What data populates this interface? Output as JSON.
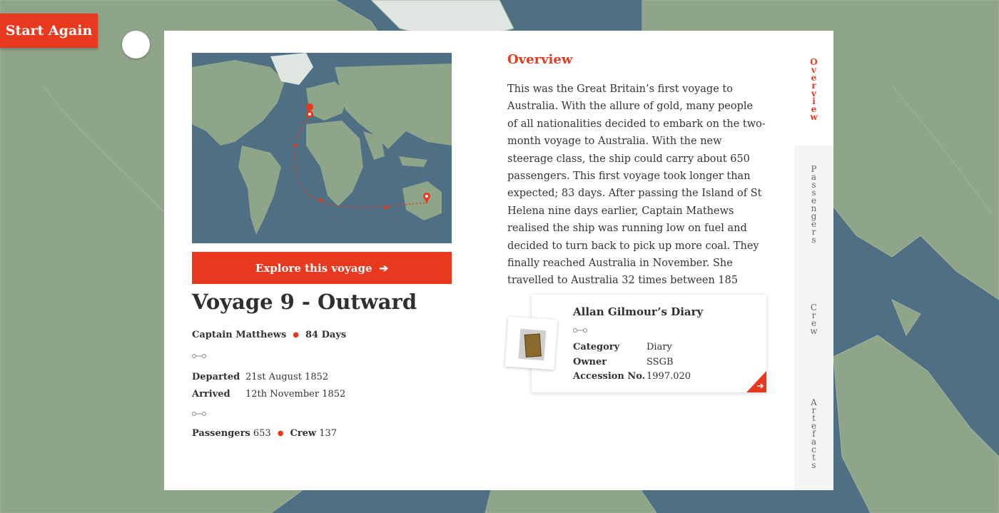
{
  "header": {
    "start_again_label": "Start Again"
  },
  "voyage": {
    "explore_label": "Explore this voyage",
    "explore_arrow": "➔",
    "title": "Voyage 9 - Outward",
    "captain": "Captain Matthews",
    "duration": "84 Days",
    "departed_label": "Departed",
    "departed_value": "21st August 1852",
    "arrived_label": "Arrived",
    "arrived_value": "12th November 1852",
    "passengers_label": "Passengers",
    "passengers_value": "653",
    "crew_label": "Crew",
    "crew_value": "137"
  },
  "overview": {
    "heading": "Overview",
    "text": "This was the Great Britain’s first voyage to Australia. With the allure of gold, many people of all nationalities decided to embark on the two-month voyage to Australia. With the new steerage class, the ship could carry about 650 passengers.   This first voyage took longer than expected; 83 days. After passing the Island of St Helena nine days earlier, Captain Mathews realised the ship was running low on fuel and decided to turn back to pick up more coal. They finally reached Australia in November. She travelled to Australia 32 times between 185"
  },
  "diary": {
    "title": "Allan Gilmour’s Diary",
    "category_label": "Category",
    "category_value": "Diary",
    "owner_label": "Owner",
    "owner_value": "SSGB",
    "accession_label": "Accession No.",
    "accession_value": "1997.020"
  },
  "tabs": [
    {
      "label": "Overview",
      "active": true
    },
    {
      "label": "Passengers",
      "active": false
    },
    {
      "label": "Crew",
      "active": false
    },
    {
      "label": "Artefacts",
      "active": false
    }
  ],
  "colors": {
    "accent": "#e8391e",
    "ocean": "#4e6f84",
    "land": "#8fa58a"
  }
}
